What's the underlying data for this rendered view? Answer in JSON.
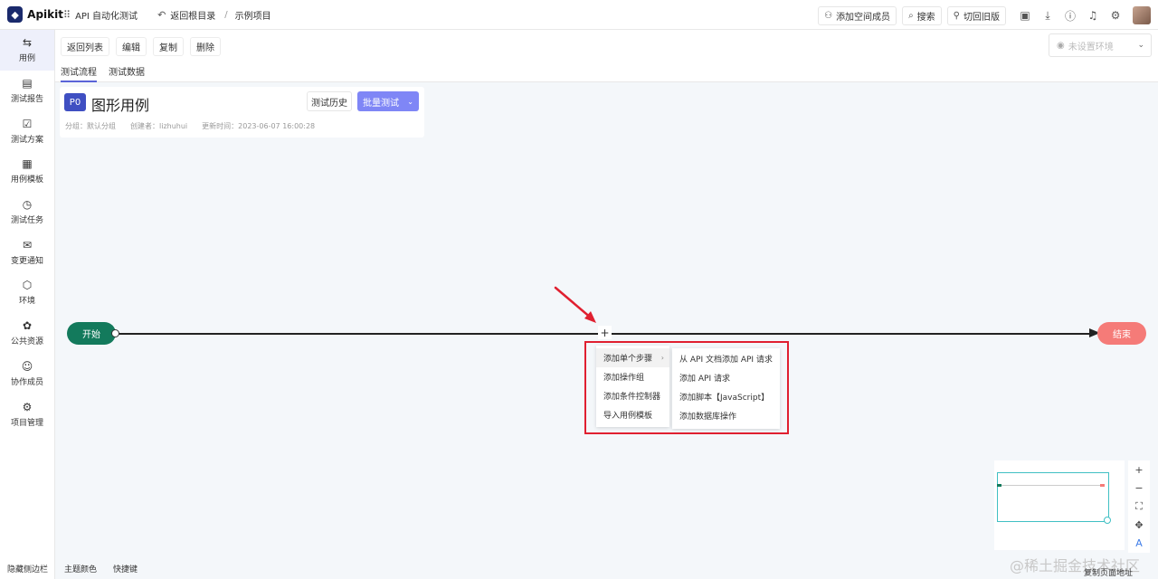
{
  "app": {
    "logo_mark": "◆",
    "name": "Apikit"
  },
  "topbar": {
    "project": "API 自动化测试",
    "back_root": "返回根目录",
    "separator": "/",
    "breadcrumb": "示例项目",
    "add_member": "添加空间成员",
    "search": "搜索",
    "switch_old": "切回旧版"
  },
  "toolbar": {
    "buttons": [
      "返回列表",
      "编辑",
      "复制",
      "删除"
    ],
    "env_placeholder": "未设置环境",
    "tabs": [
      "测试流程",
      "测试数据"
    ]
  },
  "sidebar": {
    "items": [
      {
        "label": "用例",
        "icon": "⇆"
      },
      {
        "label": "测试报告",
        "icon": "▤"
      },
      {
        "label": "测试方案",
        "icon": "☑"
      },
      {
        "label": "用例模板",
        "icon": "▦"
      },
      {
        "label": "测试任务",
        "icon": "◷"
      },
      {
        "label": "变更通知",
        "icon": "✉"
      },
      {
        "label": "环境",
        "icon": "⬡"
      },
      {
        "label": "公共资源",
        "icon": "✿"
      },
      {
        "label": "协作成员",
        "icon": "☺"
      },
      {
        "label": "项目管理",
        "icon": "⚙"
      }
    ],
    "bottom": [
      "隐藏侧边栏",
      "主题颜色",
      "快捷键"
    ]
  },
  "case": {
    "priority": "P0",
    "title": "图形用例",
    "history_btn": "测试历史",
    "batch_btn": "批量测试",
    "meta_group": "分组：默认分组",
    "meta_creator": "创建者：lizhuhui",
    "meta_updated": "更新时间：2023-06-07 16:00:28"
  },
  "flow": {
    "start": "开始",
    "end": "结束",
    "plus": "+"
  },
  "menu": {
    "items": [
      "添加单个步骤",
      "添加操作组",
      "添加条件控制器",
      "导入用例模板"
    ],
    "submenu": [
      "从 API 文档添加 API 请求",
      "添加 API 请求",
      "添加脚本【JavaScript】",
      "添加数据库操作"
    ]
  },
  "zoom": [
    "+",
    "−",
    "⛶",
    "✥",
    "A"
  ],
  "watermark": "@稀土掘金技术社区",
  "copy_address": "复制页面地址",
  "colors": {
    "accent": "#7f86f6",
    "start": "#137a5c",
    "end": "#f57b78",
    "highlight": "#e02030"
  }
}
